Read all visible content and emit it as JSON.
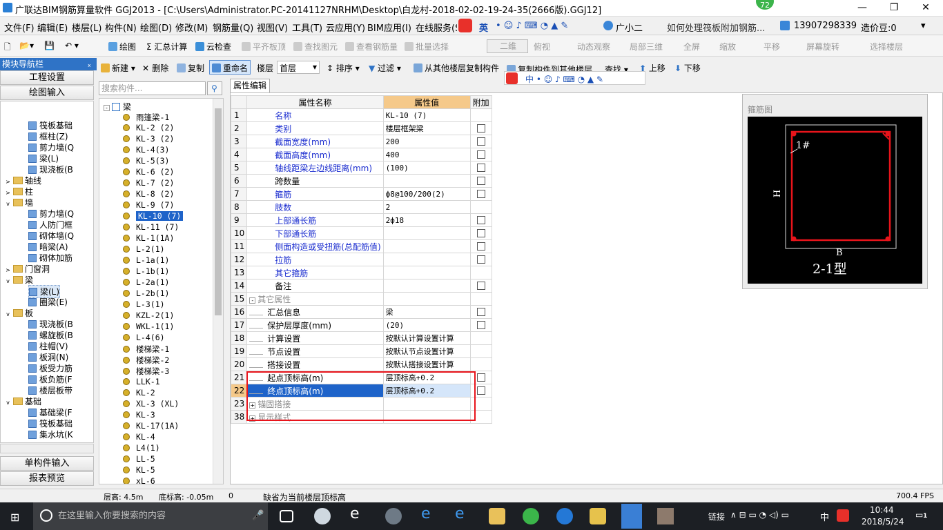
{
  "titlebar": {
    "title": "广联达BIM钢筋算量软件 GGJ2013 - [C:\\Users\\Administrator.PC-20141127NRHM\\Desktop\\白龙村-2018-02-02-19-24-35(2666版).GGJ12]",
    "badge": "72",
    "min": "—",
    "max": "❐",
    "close": "✕"
  },
  "menubar": {
    "items": [
      "文件(F)",
      "编辑(E)",
      "楼层(L)",
      "构件(N)",
      "绘图(D)",
      "修改(M)",
      "钢筋量(Q)",
      "视图(V)",
      "工具(T)",
      "云应用(Y)",
      "BIM应用(I)",
      "在线服务(S"
    ],
    "ime": "英",
    "assistant": "广小二",
    "question": "如何处理筏板附加钢筋...",
    "phone": "13907298339",
    "points": "造价豆:0"
  },
  "toolbar1": {
    "draw": "绘图",
    "sum": "Σ 汇总计算",
    "cloud": "云检查",
    "flat": "平齐板顶",
    "find": "查找图元",
    "check": "查看钢筋量",
    "batch": "批量选择",
    "view2d": "二维",
    "top": "俯视",
    "dyn": "动态观察",
    "local3d": "局部三维",
    "full": "全屏",
    "zoom": "缩放",
    "pan": "平移",
    "rotate": "屏幕旋转",
    "floor": "选择楼层"
  },
  "nav": {
    "header": "模块导航栏",
    "pin": "ₓ",
    "project": "工程设置",
    "drawing": "绘图输入",
    "single": "单构件输入",
    "report": "报表预览"
  },
  "navtree": [
    {
      "t": "筏板基础",
      "lvl": 2,
      "ico": true
    },
    {
      "t": "框柱(Z)",
      "lvl": 2,
      "ico": true
    },
    {
      "t": "剪力墙(Q",
      "lvl": 2,
      "ico": true
    },
    {
      "t": "梁(L)",
      "lvl": 2,
      "ico": true
    },
    {
      "t": "现浇板(B",
      "lvl": 2,
      "ico": true
    },
    {
      "t": "轴线",
      "lvl": 1,
      "fold": "+"
    },
    {
      "t": "柱",
      "lvl": 1,
      "fold": "+"
    },
    {
      "t": "墙",
      "lvl": 1,
      "fold": "-"
    },
    {
      "t": "剪力墙(Q",
      "lvl": 2,
      "ico": true
    },
    {
      "t": "人防门框",
      "lvl": 2,
      "ico": true
    },
    {
      "t": "砌体墙(Q",
      "lvl": 2,
      "ico": true
    },
    {
      "t": "暗梁(A)",
      "lvl": 2,
      "ico": true
    },
    {
      "t": "砌体加筋",
      "lvl": 2,
      "ico": true
    },
    {
      "t": "门窗洞",
      "lvl": 1,
      "fold": "+"
    },
    {
      "t": "梁",
      "lvl": 1,
      "fold": "-"
    },
    {
      "t": "梁(L)",
      "lvl": 2,
      "ico": true,
      "sel": true
    },
    {
      "t": "圈梁(E)",
      "lvl": 2,
      "ico": true
    },
    {
      "t": "板",
      "lvl": 1,
      "fold": "-"
    },
    {
      "t": "现浇板(B",
      "lvl": 2,
      "ico": true
    },
    {
      "t": "螺旋板(B",
      "lvl": 2,
      "ico": true
    },
    {
      "t": "柱帽(V)",
      "lvl": 2,
      "ico": true
    },
    {
      "t": "板洞(N)",
      "lvl": 2,
      "ico": true
    },
    {
      "t": "板受力筋",
      "lvl": 2,
      "ico": true
    },
    {
      "t": "板负筋(F",
      "lvl": 2,
      "ico": true
    },
    {
      "t": "楼层板带",
      "lvl": 2,
      "ico": true
    },
    {
      "t": "基础",
      "lvl": 1,
      "fold": "-"
    },
    {
      "t": "基础梁(F",
      "lvl": 2,
      "ico": true
    },
    {
      "t": "筏板基础",
      "lvl": 2,
      "ico": true
    },
    {
      "t": "集水坑(K",
      "lvl": 2,
      "ico": true
    }
  ],
  "comptb": {
    "new": "新建",
    "del": "删除",
    "copy": "复制",
    "rename": "重命名",
    "floor_label": "楼层",
    "floor_val": "首层",
    "sort": "排序",
    "filter": "过滤",
    "copy_from": "从其他楼层复制构件",
    "copy_to": "复制构件到其他楼层",
    "find": "查找",
    "up": "上移",
    "down": "下移"
  },
  "search_placeholder": "搜索构件...",
  "comp_root": "梁",
  "components": [
    "雨篷梁-1",
    "KL-2 (2)",
    "KL-3 (2)",
    "KL-4(3)",
    "KL-5(3)",
    "KL-6 (2)",
    "KL-7 (2)",
    "KL-8 (2)",
    "KL-9 (7)",
    "KL-10 (7)",
    "KL-11 (7)",
    "KL-1(1A)",
    "L-2(1)",
    "L-1a(1)",
    "L-1b(1)",
    "L-2a(1)",
    "L-2b(1)",
    "L-3(1)",
    "KZL-2(1)",
    "WKL-1(1)",
    "L-4(6)",
    "楼梯梁-1",
    "楼梯梁-2",
    "楼梯梁-3",
    "LLK-1",
    "KL-2",
    "XL-3 (XL)",
    "KL-3",
    "KL-17(1A)",
    "KL-4",
    "L4(1)",
    "LL-5",
    "KL-5",
    "xL-6"
  ],
  "selected_component": "KL-10 (7)",
  "prop_tab": "属性编辑",
  "prop_headers": {
    "name": "属性名称",
    "value": "属性值",
    "extra": "附加"
  },
  "props": [
    {
      "n": "1",
      "name": "名称",
      "val": "KL-10 (7)",
      "blue": true,
      "cb": false
    },
    {
      "n": "2",
      "name": "类别",
      "val": "楼层框架梁",
      "blue": true,
      "cb": true
    },
    {
      "n": "3",
      "name": "截面宽度(mm)",
      "val": "200",
      "blue": true,
      "cb": true
    },
    {
      "n": "4",
      "name": "截面高度(mm)",
      "val": "400",
      "blue": true,
      "cb": true
    },
    {
      "n": "5",
      "name": "轴线距梁左边线距离(mm)",
      "val": "(100)",
      "blue": true,
      "cb": true
    },
    {
      "n": "6",
      "name": "跨数量",
      "val": "",
      "blue": false,
      "cb": true
    },
    {
      "n": "7",
      "name": "箍筋",
      "val": "ф8@100/200(2)",
      "blue": true,
      "cb": true
    },
    {
      "n": "8",
      "name": "肢数",
      "val": "2",
      "blue": true,
      "cb": false
    },
    {
      "n": "9",
      "name": "上部通长筋",
      "val": "2ф18",
      "blue": true,
      "cb": true
    },
    {
      "n": "10",
      "name": "下部通长筋",
      "val": "",
      "blue": true,
      "cb": true
    },
    {
      "n": "11",
      "name": "侧面构造或受扭筋(总配筋值)",
      "val": "",
      "blue": true,
      "cb": true
    },
    {
      "n": "12",
      "name": "拉筋",
      "val": "",
      "blue": true,
      "cb": true
    },
    {
      "n": "13",
      "name": "其它箍筋",
      "val": "",
      "blue": true,
      "cb": false
    },
    {
      "n": "14",
      "name": "备注",
      "val": "",
      "blue": false,
      "cb": true
    },
    {
      "n": "15",
      "name": "其它属性",
      "val": "",
      "gray": true,
      "fold": "-",
      "cb": false
    },
    {
      "n": "16",
      "name": "汇总信息",
      "val": "梁",
      "sub": true,
      "cb": true
    },
    {
      "n": "17",
      "name": "保护层厚度(mm)",
      "val": "(20)",
      "sub": true,
      "cb": true
    },
    {
      "n": "18",
      "name": "计算设置",
      "val": "按默认计算设置计算",
      "sub": true,
      "cb": false
    },
    {
      "n": "19",
      "name": "节点设置",
      "val": "按默认节点设置计算",
      "sub": true,
      "cb": false
    },
    {
      "n": "20",
      "name": "搭接设置",
      "val": "按默认搭接设置计算",
      "sub": true,
      "cb": false
    },
    {
      "n": "21",
      "name": "起点顶标高(m)",
      "val": "层顶标高+0.2",
      "sub": true,
      "cb": true
    },
    {
      "n": "22",
      "name": "终点顶标高(m)",
      "val": "层顶标高+0.2",
      "sub": true,
      "cb": true,
      "sel": true
    },
    {
      "n": "23",
      "name": "锚固搭接",
      "val": "",
      "gray": true,
      "fold": "+",
      "cb": false
    },
    {
      "n": "38",
      "name": "显示样式",
      "val": "",
      "gray": true,
      "fold": "+",
      "cb": false
    }
  ],
  "rebar_preview": {
    "title": "箍筋图",
    "label_1": "1#",
    "label_h": "H",
    "label_b": "B",
    "type": "2-1型"
  },
  "statusbar": {
    "floor_h": "层高: 4.5m",
    "base_h": "底标高: -0.05m",
    "zero": "0",
    "hint": "缺省为当前楼层顶标高",
    "fps": "700.4 FPS"
  },
  "taskbar": {
    "search": "在这里输入你要搜索的内容",
    "link": "链接",
    "lang": "中",
    "time": "10:44",
    "date": "2018/5/24",
    "notif": "1"
  }
}
